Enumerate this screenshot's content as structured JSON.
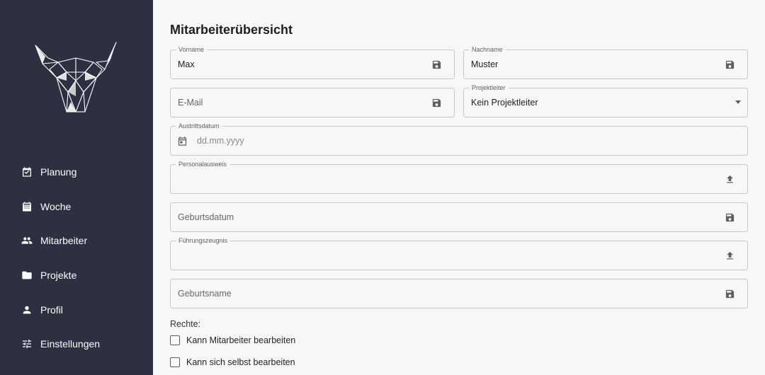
{
  "sidebar": {
    "items": [
      {
        "label": "Planung",
        "icon": "calendar-check-icon"
      },
      {
        "label": "Woche",
        "icon": "calendar-week-icon"
      },
      {
        "label": "Mitarbeiter",
        "icon": "people-icon"
      },
      {
        "label": "Projekte",
        "icon": "folder-icon"
      },
      {
        "label": "Profil",
        "icon": "person-icon"
      },
      {
        "label": "Einstellungen",
        "icon": "sliders-icon"
      }
    ]
  },
  "main": {
    "title": "Mitarbeiterübersicht",
    "fields": {
      "vorname": {
        "label": "Vorname",
        "value": "Max"
      },
      "nachname": {
        "label": "Nachname",
        "value": "Muster"
      },
      "email": {
        "placeholder": "E-Mail"
      },
      "projektleiter": {
        "label": "Projektleiter",
        "value": "Kein Projektleiter"
      },
      "austrittsdatum": {
        "label": "Austrittsdatum",
        "placeholder": "dd.mm.yyyy"
      },
      "personalausweis": {
        "label": "Personalausweis"
      },
      "geburtsdatum": {
        "placeholder": "Geburtsdatum"
      },
      "fuehrungszeugnis": {
        "label": "Führungszeugnis"
      },
      "geburtsname": {
        "placeholder": "Geburtsname"
      }
    },
    "rights": {
      "label": "Rechte:",
      "options": [
        {
          "label": "Kann Mitarbeiter bearbeiten",
          "checked": false
        },
        {
          "label": "Kann sich selbst bearbeiten",
          "checked": false
        }
      ]
    }
  },
  "colors": {
    "sidebar_bg": "#2c3041",
    "page_bg": "#f6f7f6",
    "icon": "#5f5f5f"
  }
}
